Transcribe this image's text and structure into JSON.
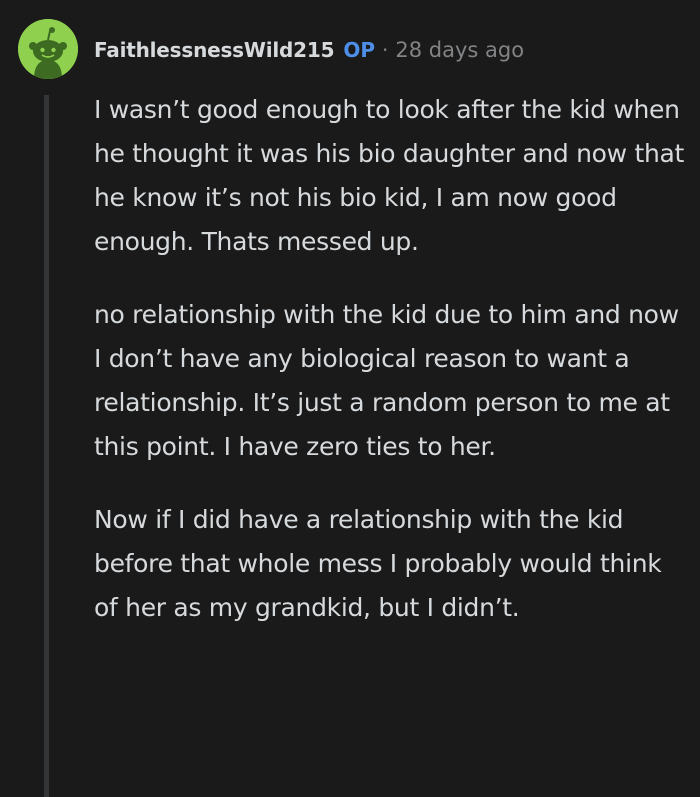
{
  "comment": {
    "author": "FaithlessnessWild215",
    "op_badge": "OP",
    "separator": "·",
    "timestamp": "28 days ago",
    "avatar_icon": "reddit-snoo-avatar-icon",
    "colors": {
      "background": "#1a1a1b",
      "text": "#d7dadc",
      "meta": "#818384",
      "op": "#4d8ee8",
      "avatar_bg": "#8fd14f",
      "thread_line": "#343536"
    },
    "paragraphs": [
      "I wasn’t good enough to look after the kid when he thought it was his bio daughter and now that he know it’s not his bio kid, I am now good enough. Thats messed up.",
      "no relationship with the kid due to him and now I don’t have any biological reason to want a relationship. It’s just a random person to me at this point. I have zero ties to her.",
      "Now if I did have a relationship with the kid before that whole mess I probably would think of her as my grandkid, but I didn’t."
    ]
  }
}
